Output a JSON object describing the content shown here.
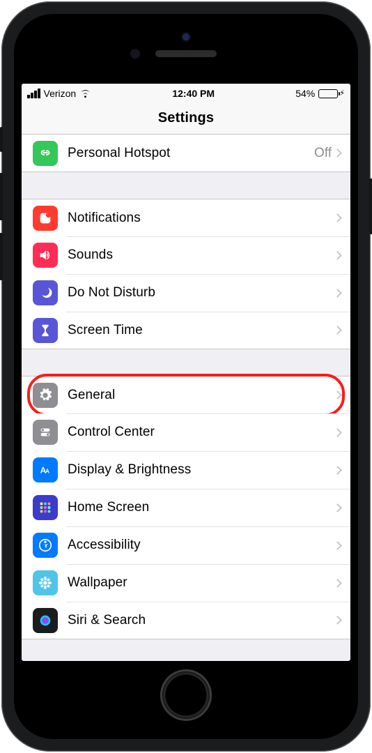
{
  "status": {
    "carrier": "Verizon",
    "time": "12:40 PM",
    "battery_pct": "54%"
  },
  "nav": {
    "title": "Settings"
  },
  "group1": [
    {
      "name": "personal-hotspot",
      "label": "Personal Hotspot",
      "value": "Off",
      "iconBg": "bg-green",
      "icon": "link"
    }
  ],
  "group2": [
    {
      "name": "notifications",
      "label": "Notifications",
      "iconBg": "bg-red",
      "icon": "notif"
    },
    {
      "name": "sounds",
      "label": "Sounds",
      "iconBg": "bg-pink",
      "icon": "speaker"
    },
    {
      "name": "do-not-disturb",
      "label": "Do Not Disturb",
      "iconBg": "bg-purple",
      "icon": "moon"
    },
    {
      "name": "screen-time",
      "label": "Screen Time",
      "iconBg": "bg-purple",
      "icon": "hourglass"
    }
  ],
  "group3": [
    {
      "name": "general",
      "label": "General",
      "iconBg": "bg-gray",
      "icon": "gear",
      "highlight": true
    },
    {
      "name": "control-center",
      "label": "Control Center",
      "iconBg": "bg-gray",
      "icon": "switches"
    },
    {
      "name": "display",
      "label": "Display & Brightness",
      "iconBg": "bg-blue",
      "icon": "aa"
    },
    {
      "name": "home-screen",
      "label": "Home Screen",
      "iconBg": "bg-blue",
      "icon": "grid"
    },
    {
      "name": "accessibility",
      "label": "Accessibility",
      "iconBg": "bg-blue",
      "icon": "person"
    },
    {
      "name": "wallpaper",
      "label": "Wallpaper",
      "iconBg": "bg-cyan",
      "icon": "flower"
    },
    {
      "name": "siri",
      "label": "Siri & Search",
      "iconBg": "bg-dark",
      "icon": "siri"
    }
  ]
}
